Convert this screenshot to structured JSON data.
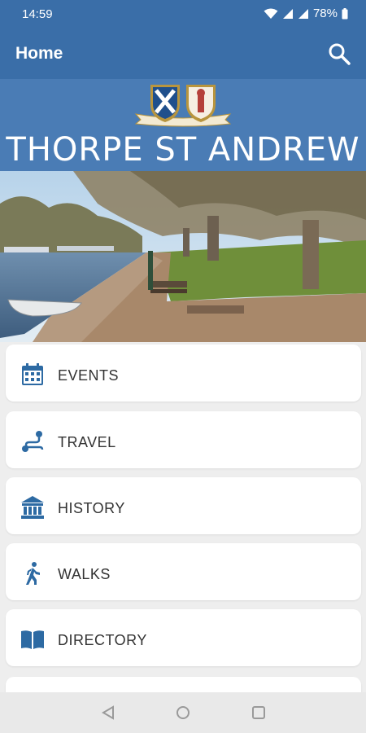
{
  "status": {
    "time": "14:59",
    "battery": "78%"
  },
  "appbar": {
    "title": "Home",
    "search_icon": "search-icon"
  },
  "banner": {
    "town": "THORPE ST ANDREW",
    "crest_icon": "crest-icon"
  },
  "photo": {
    "icon": "riverside-photo"
  },
  "menu": {
    "items": [
      {
        "label": "EVENTS",
        "icon": "calendar-icon"
      },
      {
        "label": "TRAVEL",
        "icon": "route-icon"
      },
      {
        "label": "HISTORY",
        "icon": "museum-icon"
      },
      {
        "label": "WALKS",
        "icon": "walking-icon"
      },
      {
        "label": "DIRECTORY",
        "icon": "book-icon"
      }
    ]
  },
  "colors": {
    "primary": "#3a6ea8",
    "banner": "#4a7cb5",
    "card": "#ffffff",
    "background": "#eeeeee"
  }
}
